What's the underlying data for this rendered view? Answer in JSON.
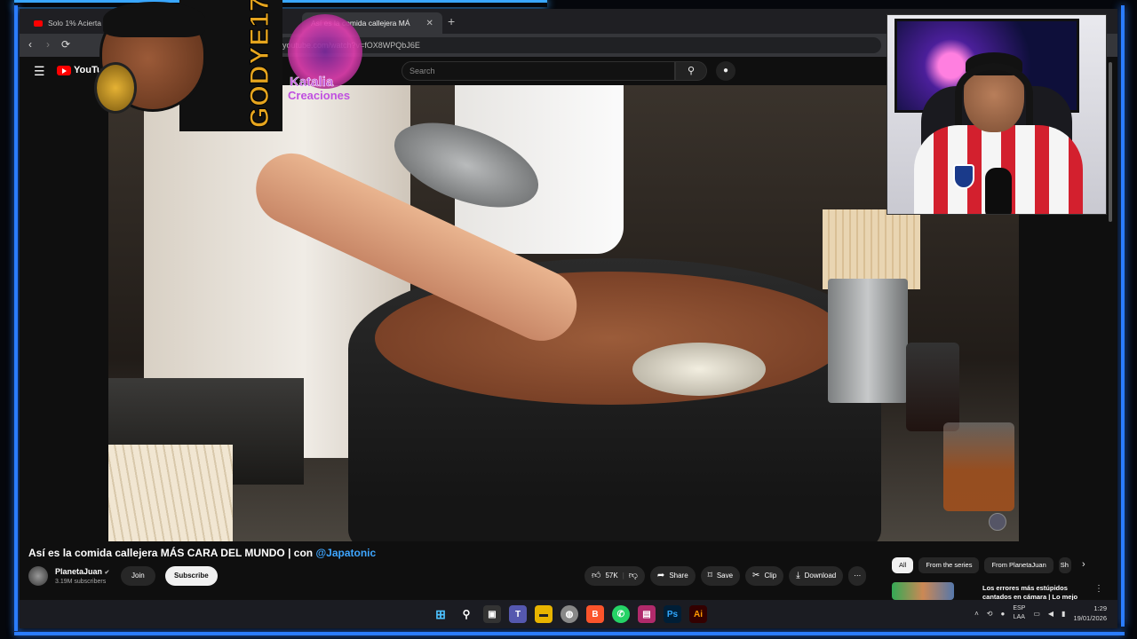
{
  "browser": {
    "tabs": [
      {
        "label": "Solo 1% Acierta 200 ",
        "active": false
      },
      {
        "label": "Así es la comida callejera MÁ",
        "active": true
      }
    ],
    "url": "youtube.com/watch?v=fOX8WPQbJ6E",
    "new_tab": "+",
    "back": "‹",
    "forward": "›",
    "reload": "⟳"
  },
  "youtube": {
    "logo": "YouTube",
    "search_placeholder": "Search"
  },
  "video": {
    "title_main": "Así es la comida callejera MÁS CARA DEL MUNDO | con ",
    "title_mention": "@Japatonic",
    "channel_name": "PlanetaJuan",
    "channel_verified": "✔",
    "subscribers": "3.19M subscribers",
    "join_label": "Join",
    "subscribe_label": "Subscribe",
    "likes": "57K",
    "share_label": "Share",
    "save_label": "Save",
    "clip_label": "Clip",
    "download_label": "Download",
    "more_label": "⋯"
  },
  "sidebar": {
    "chips": [
      "All",
      "From the series",
      "From PlanetaJuan",
      "Sh"
    ],
    "recommended_title": "Los errores más estúpidos cantados en cámara | Lo mejo"
  },
  "overlays": {
    "streamer_tag": "GODYE17",
    "logo_line1": "Katalia",
    "logo_line2": "Creaciones"
  },
  "taskbar": {
    "lang_line1": "ESP",
    "lang_line2": "LAA",
    "time": "1:29",
    "date": "19/01/2026"
  },
  "colors": {
    "accent_blue": "#2a7cff",
    "youtube_red": "#ff0000",
    "mention_blue": "#3ea6ff"
  }
}
